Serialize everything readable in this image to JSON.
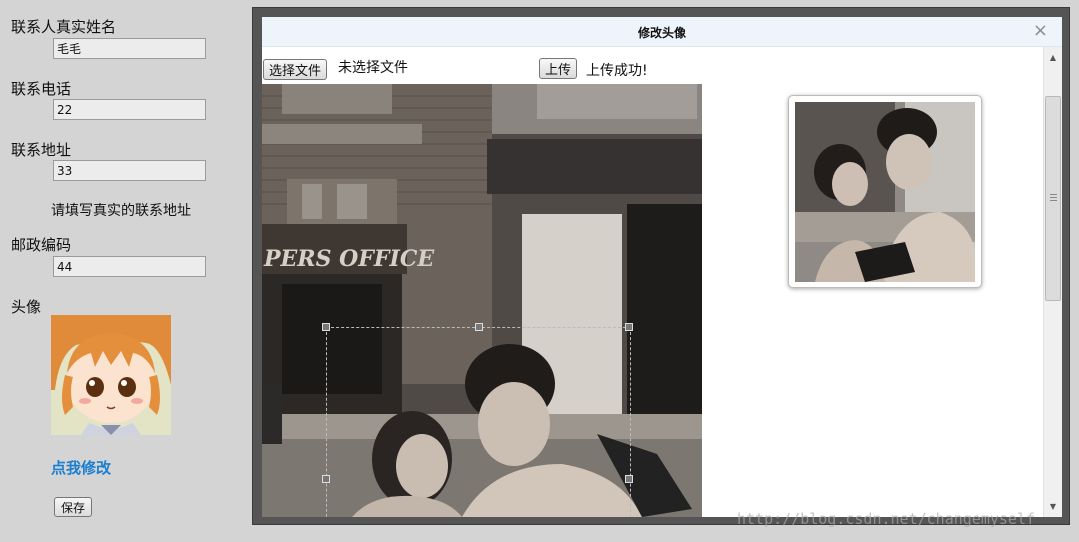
{
  "form": {
    "name_label": "联系人真实姓名",
    "name_value": "毛毛",
    "phone_label": "联系电话",
    "phone_value": "22",
    "address_label": "联系地址",
    "address_value": "33",
    "address_hint": "请填写真实的联系地址",
    "postcode_label": "邮政编码",
    "postcode_value": "44",
    "avatar_label": "头像",
    "edit_link": "点我修改",
    "save_label": "保存"
  },
  "modal": {
    "title": "修改头像",
    "close_glyph": "×",
    "choose_file_label": "选择文件",
    "file_status": "未选择文件",
    "upload_label": "上传",
    "upload_status": "上传成功!"
  },
  "photo": {
    "sign_text": "PERS OFFICE"
  },
  "scrollbar": {
    "up_glyph": "▲",
    "down_glyph": "▼"
  },
  "watermark": "http://blog.csdn.net/changemyself",
  "colors": {
    "link": "#1a7fd0",
    "modal_frame": "#555555",
    "titlebar": "#eef4fb"
  },
  "icons": [
    "close-icon",
    "scroll-up-icon",
    "scroll-down-icon",
    "scroll-grip-icon"
  ]
}
